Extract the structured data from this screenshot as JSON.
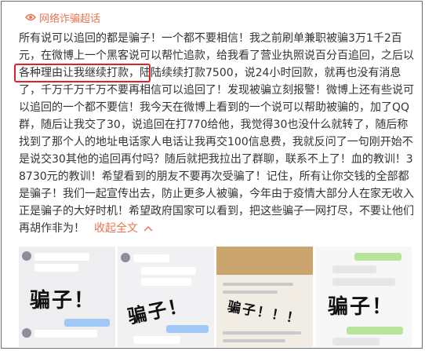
{
  "topic": {
    "icon": "superhashtag-icon",
    "label": "网络诈骗超话",
    "accent": "#eb7350"
  },
  "post": {
    "text": "所有说可以追回的都是骗子！一个都不要相信！我之前刷单兼职被骗3万1千2百元，在微博上一个黑客说可以帮忙追款，给我看了营业执照说百分百追回，之后以各种理由让我继续打款，陆陆续续打款7500，说24小时回款，就再也没有消息了，千万千万千万不要再相信可以追回了！发现被骗立刻报警！微博上还有些说可以追回的一个都不要信！我今天在微博上看到的一个说可以帮助被骗的，加了QQ群，随后让我交了30，说追回在打770给他，我觉得30也没什么就转了，随后称找到了那个人的地址电话家人电话让我再交100信息费，我就反问了一句刚开始不是说交30其他的追回再付吗？随后就把我拉出了群聊，联系不上了！血的教训！38730元的教训！希望看到的朋友不要再次受骗了！记住，所有让你交钱的全部都是骗子！我们一起宣传出去，防止更多人被骗，今年由于疫情大部分人在家无收入正是骗子的大好时机！希望政府国家可以看到，把这些骗子一网打尽，不要让他们再胡作非为！",
    "collapse_label": "收起全文",
    "collapse_icon": "chevron-up-icon",
    "highlight_color": "#e0202a"
  },
  "images": [
    {
      "overlay": "骗子！",
      "kind": "chat-screenshot"
    },
    {
      "overlay": "骗子！",
      "kind": "chat-screenshot"
    },
    {
      "overlay": "骗子！！！",
      "kind": "company-page-screenshot"
    },
    {
      "overlay": "骗子！",
      "kind": "chat-screenshot"
    }
  ]
}
